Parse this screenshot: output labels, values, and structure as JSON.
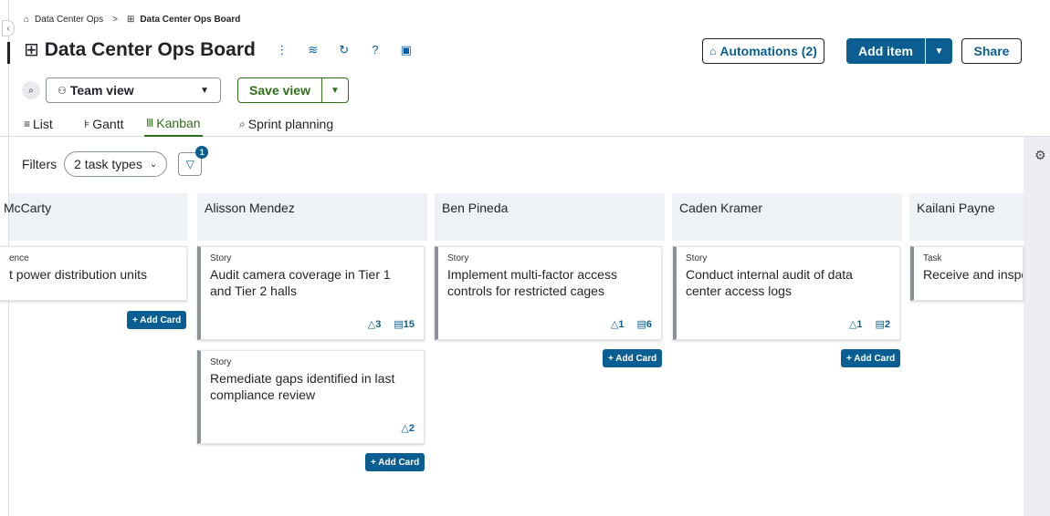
{
  "breadcrumb": {
    "home_icon": "home-icon",
    "parent": "Data Center Ops",
    "separator": ">",
    "board_icon": "board-icon",
    "current": "Data Center Ops Board"
  },
  "header": {
    "title_icon": "board-icon",
    "title": "Data Center Ops Board",
    "tools": [
      "more-icon",
      "settings-sliders-icon",
      "refresh-icon",
      "help-icon",
      "calendar-settings-icon"
    ],
    "automations_icon": "robot-icon",
    "automations_label": "Automations (2)",
    "add_item_label": "Add item",
    "share_label": "Share"
  },
  "view": {
    "selected": "Team view",
    "save_label": "Save view"
  },
  "tabs": [
    {
      "label": "List",
      "icon": "list-icon",
      "active": false
    },
    {
      "label": "Gantt",
      "icon": "gantt-icon",
      "active": false
    },
    {
      "label": "Kanban",
      "icon": "kanban-icon",
      "active": true
    },
    {
      "label": "Sprint planning",
      "icon": "sprint-icon",
      "active": false
    }
  ],
  "filters": {
    "label": "Filters",
    "pill": "2 task types",
    "count": "1"
  },
  "columns": [
    {
      "name": "McCarty",
      "cards": [
        {
          "type": "ence",
          "title": "t power distribution units",
          "counts": []
        }
      ],
      "add_label": "+ Add Card"
    },
    {
      "name": "Alisson Mendez",
      "cards": [
        {
          "type": "Story",
          "title": "Audit camera coverage in Tier 1 and Tier 2 halls",
          "counts": [
            "3",
            "15"
          ]
        },
        {
          "type": "Story",
          "title": "Remediate gaps identified in last compliance review",
          "counts": [
            "2"
          ]
        }
      ],
      "add_label": "+ Add Card"
    },
    {
      "name": "Ben Pineda",
      "cards": [
        {
          "type": "Story",
          "title": "Implement multi-factor access controls for restricted cages",
          "counts": [
            "1",
            "6"
          ]
        }
      ],
      "add_label": "+ Add Card"
    },
    {
      "name": "Caden Kramer",
      "cards": [
        {
          "type": "Story",
          "title": "Conduct internal audit of data center access logs",
          "counts": [
            "1",
            "2"
          ]
        }
      ],
      "add_label": "+ Add Card"
    },
    {
      "name": "Kailani Payne",
      "cards": [
        {
          "type": "Task",
          "title": "Receive and inspe",
          "counts": []
        }
      ]
    }
  ],
  "colors": {
    "primary": "#0b5e91",
    "green": "#2f6f1a",
    "column_bg": "#eef2f6"
  }
}
